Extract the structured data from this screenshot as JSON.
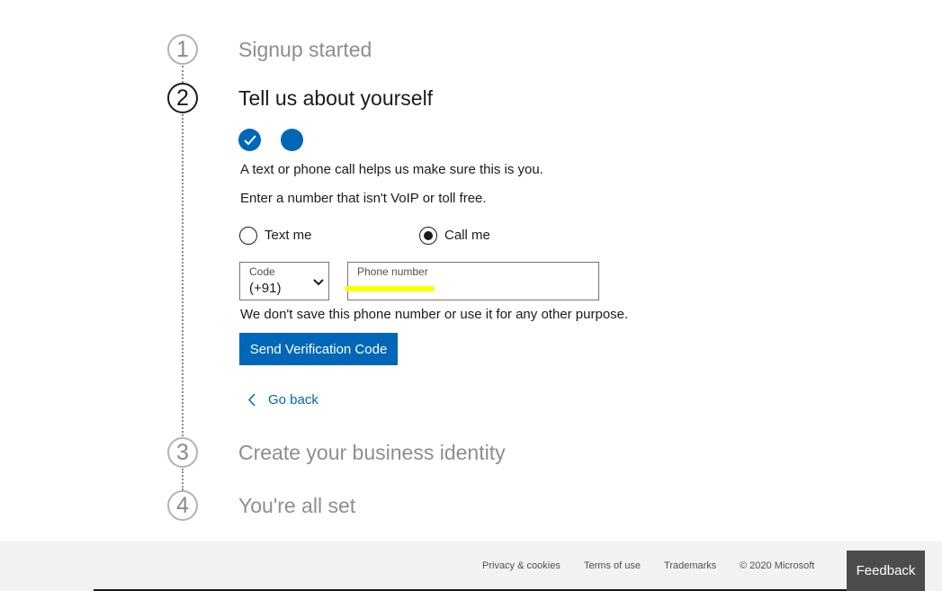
{
  "steps": [
    {
      "number": "1",
      "title": "Signup started"
    },
    {
      "number": "2",
      "title": "Tell us about yourself"
    },
    {
      "number": "3",
      "title": "Create your business identity"
    },
    {
      "number": "4",
      "title": "You're all set"
    }
  ],
  "verify": {
    "info_text": "A text or phone call helps us make sure this is you.",
    "instruction_text": "Enter a number that isn't VoIP or toll free.",
    "options": [
      {
        "label": "Text me",
        "selected": false
      },
      {
        "label": "Call me",
        "selected": true
      }
    ],
    "code_label": "Code",
    "code_value": "(+91)",
    "phone_label": "Phone number",
    "privacy_note": "We don't save this phone number or use it for any other purpose.",
    "send_button": "Send Verification Code",
    "go_back": "Go back"
  },
  "footer": {
    "links": [
      "Privacy & cookies",
      "Terms of use",
      "Trademarks",
      "© 2020 Microsoft"
    ],
    "feedback": "Feedback"
  },
  "colors": {
    "accent": "#0067b8",
    "highlight": "#ffff00"
  }
}
